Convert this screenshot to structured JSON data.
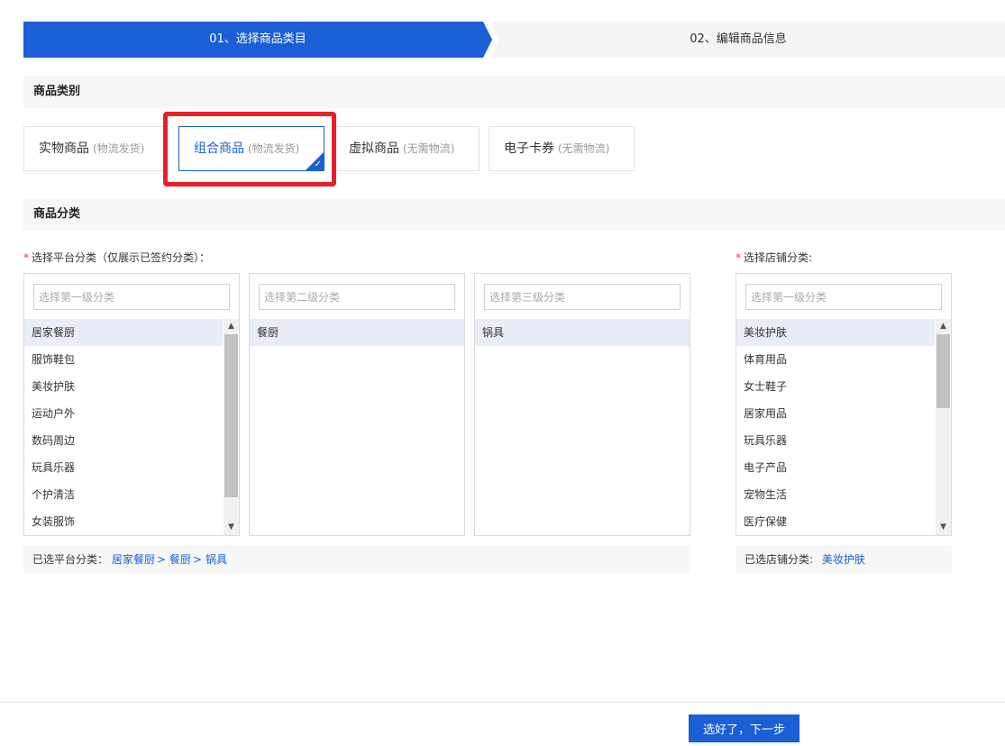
{
  "steps": [
    {
      "label": "01、选择商品类目",
      "active": true
    },
    {
      "label": "02、编辑商品信息",
      "active": false
    }
  ],
  "sections": {
    "type_title": "商品类别",
    "category_title": "商品分类"
  },
  "product_types": [
    {
      "name": "实物商品",
      "sub": "(物流发货)",
      "selected": false
    },
    {
      "name": "组合商品",
      "sub": "(物流发货)",
      "selected": true
    },
    {
      "name": "虚拟商品",
      "sub": "(无需物流)",
      "selected": false
    },
    {
      "name": "电子卡券",
      "sub": "(无需物流)",
      "selected": false
    }
  ],
  "platform": {
    "required_mark": "*",
    "label": "选择平台分类（仅展示已签约分类）：",
    "level1": {
      "placeholder": "选择第一级分类",
      "items": [
        "居家餐厨",
        "服饰鞋包",
        "美妆护肤",
        "运动户外",
        "数码周边",
        "玩具乐器",
        "个护清洁",
        "女装服饰"
      ],
      "selected_index": 0
    },
    "level2": {
      "placeholder": "选择第二级分类",
      "items": [
        "餐厨"
      ],
      "selected_index": 0
    },
    "level3": {
      "placeholder": "选择第三级分类",
      "items": [
        "锅具"
      ],
      "selected_index": 0
    },
    "summary_label": "已选平台分类：",
    "summary_path": [
      "居家餐厨",
      "餐厨",
      "锅具"
    ],
    "summary_sep": ">"
  },
  "shop": {
    "required_mark": "*",
    "label": "选择店铺分类:",
    "level1": {
      "placeholder": "选择第一级分类",
      "items": [
        "美妆护肤",
        "体育用品",
        "女士鞋子",
        "居家用品",
        "玩具乐器",
        "电子产品",
        "宠物生活",
        "医疗保健"
      ],
      "selected_index": 0
    },
    "summary_label": "已选店铺分类:",
    "summary_value": "美妆护肤"
  },
  "footer": {
    "next_label": "选好了，下一步"
  },
  "colors": {
    "accent": "#1a5fd6",
    "highlight": "#ea1e2a",
    "required": "#e4393c"
  }
}
